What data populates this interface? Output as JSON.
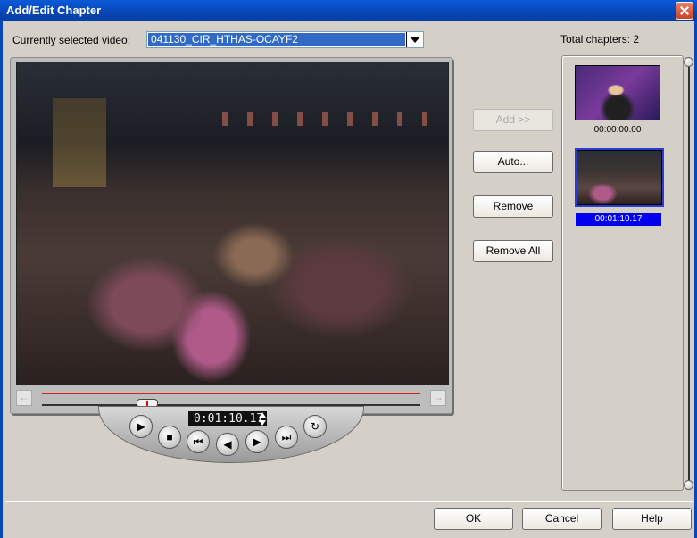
{
  "window": {
    "title": "Add/Edit Chapter"
  },
  "video_selector": {
    "label": "Currently selected video:",
    "selected": "041130_CIR_HTHAS-OCAYF2"
  },
  "total_chapters_label": "Total chapters: 2",
  "playback": {
    "timecode": "0:01:10.17"
  },
  "actions": {
    "add": "Add >>",
    "auto": "Auto...",
    "remove": "Remove",
    "remove_all": "Remove All"
  },
  "chapters": [
    {
      "time": "00:00:00.00",
      "selected": false
    },
    {
      "time": "00:01:10.17",
      "selected": true
    }
  ],
  "footer": {
    "ok": "OK",
    "cancel": "Cancel",
    "help": "Help"
  },
  "icons": {
    "play": "play-icon",
    "stop": "stop-icon",
    "prev": "skip-back-icon",
    "step_back": "step-back-icon",
    "step_fwd": "step-forward-icon",
    "next": "skip-forward-icon",
    "loop": "loop-icon"
  },
  "colors": {
    "titlebar": "#0747b6",
    "selection": "#316ac5",
    "chapter_selected": "#0000ee"
  }
}
